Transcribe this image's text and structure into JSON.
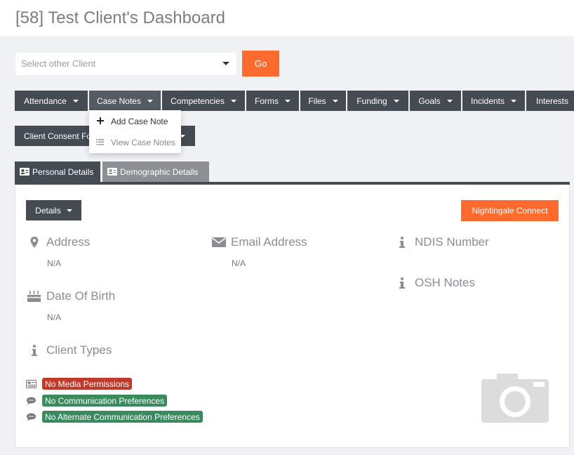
{
  "header": {
    "title": "[58] Test Client's Dashboard"
  },
  "client_select": {
    "placeholder": "Select other Client",
    "go_label": "Go"
  },
  "nav": {
    "attendance": "Attendance",
    "case_notes": "Case Notes",
    "competencies": "Competencies",
    "forms": "Forms",
    "files": "Files",
    "funding": "Funding",
    "goals": "Goals",
    "incidents": "Incidents",
    "interests": "Interests",
    "client_consent": "Client Consent Fo"
  },
  "case_notes_menu": {
    "add": "Add Case Note",
    "view": "View Case Notes"
  },
  "tabs": {
    "personal": "Personal Details",
    "demographic": "Demographic Details"
  },
  "card": {
    "details_label": "Details",
    "nightingale_label": "Nightingale Connect",
    "fields": {
      "address": {
        "label": "Address",
        "value": "N/A"
      },
      "email": {
        "label": "Email Address",
        "value": "N/A"
      },
      "ndis": {
        "label": "NDIS Number"
      },
      "osh": {
        "label": "OSH Notes"
      },
      "dob": {
        "label": "Date Of Birth",
        "value": "N/A"
      },
      "client_types": {
        "label": "Client Types"
      }
    },
    "badges": {
      "media": "No Media Permissions",
      "communication": "No Communication Preferences",
      "alternate": "No Alternate Communication Preferences"
    }
  },
  "colors": {
    "accent": "#ff6a2f",
    "nav": "#444b52",
    "badge_red": "#c0392b",
    "badge_green": "#3a8a5e"
  }
}
